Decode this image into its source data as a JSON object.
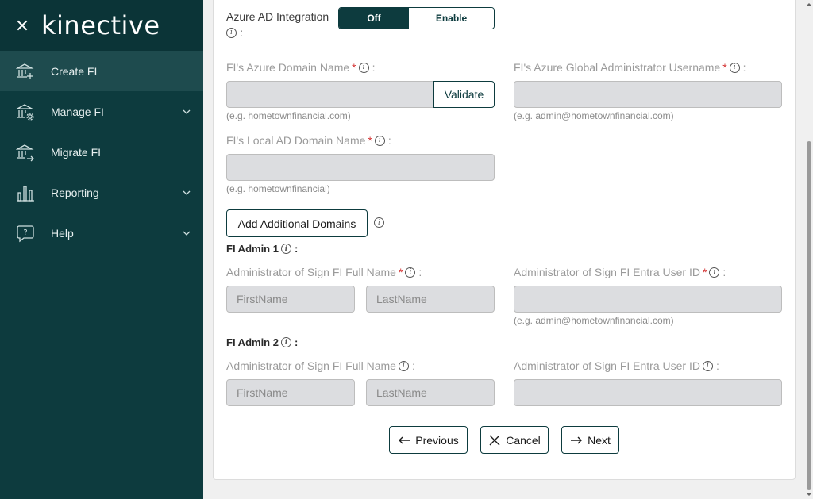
{
  "sidebar": {
    "logo": "kinective",
    "items": [
      {
        "label": "Create FI",
        "icon": "bank-add-icon",
        "expandable": false
      },
      {
        "label": "Manage FI",
        "icon": "bank-gear-icon",
        "expandable": true
      },
      {
        "label": "Migrate FI",
        "icon": "bank-arrow-icon",
        "expandable": false
      },
      {
        "label": "Reporting",
        "icon": "bar-chart-icon",
        "expandable": true
      },
      {
        "label": "Help",
        "icon": "help-icon",
        "expandable": true
      }
    ]
  },
  "form": {
    "azure_ad": {
      "label": "Azure AD Integration",
      "colon": ":",
      "off": "Off",
      "enable": "Enable"
    },
    "azure_domain": {
      "label": "FI's Azure Domain Name",
      "value": "",
      "hint": "(e.g. hometownfinancial.com)",
      "validate": "Validate"
    },
    "azure_admin": {
      "label": "FI's Azure Global Administrator Username",
      "value": "",
      "hint": "(e.g. admin@hometownfinancial.com)"
    },
    "local_domain": {
      "label": "FI's Local AD Domain Name",
      "value": "",
      "hint": "(e.g. hometownfinancial)"
    },
    "add_domains": "Add Additional Domains",
    "admin1": {
      "title": "FI Admin 1",
      "full_name_label": "Administrator of Sign FI Full Name",
      "first_placeholder": "FirstName",
      "last_placeholder": "LastName",
      "user_id_label": "Administrator of Sign FI Entra User ID",
      "user_id_hint": "(e.g. admin@hometownfinancial.com)"
    },
    "admin2": {
      "title": "FI Admin 2",
      "full_name_label": "Administrator of Sign FI Full Name",
      "first_placeholder": "FirstName",
      "last_placeholder": "LastName",
      "user_id_label": "Administrator of Sign FI Entra User ID"
    }
  },
  "buttons": {
    "previous": "Previous",
    "cancel": "Cancel",
    "next": "Next"
  },
  "colors": {
    "sidebar": "#0d3b3e",
    "active": "#1e4b4e",
    "required": "#d32f2f"
  }
}
